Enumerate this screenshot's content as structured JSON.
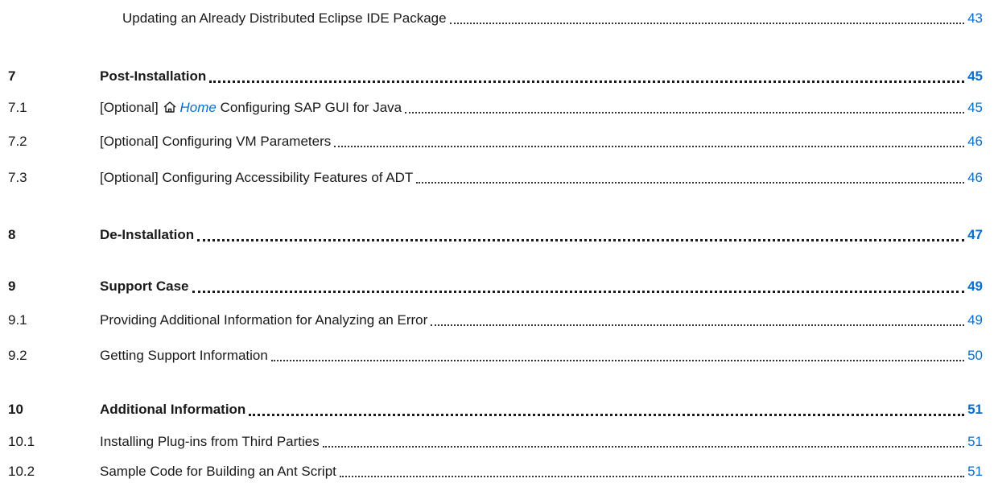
{
  "toc": {
    "r0": {
      "title": "Updating an Already Distributed Eclipse IDE Package",
      "page": "43"
    },
    "r1": {
      "num": "7",
      "title": "Post-Installation",
      "page": "45"
    },
    "r2": {
      "num": "7.1",
      "title_prefix": "[Optional] ",
      "link_icon": "home-icon",
      "link_text": "Home",
      "title_suffix": " Configuring SAP GUI for Java",
      "page": "45"
    },
    "r3": {
      "num": "7.2",
      "title": "[Optional] Configuring VM Parameters",
      "page": "46"
    },
    "r4": {
      "num": "7.3",
      "title": "[Optional] Configuring Accessibility Features of ADT",
      "page": "46"
    },
    "r5": {
      "num": "8",
      "title": "De-Installation",
      "page": "47"
    },
    "r6": {
      "num": "9",
      "title": "Support Case",
      "page": "49"
    },
    "r7": {
      "num": "9.1",
      "title": "Providing Additional Information for Analyzing an Error",
      "page": "49"
    },
    "r8": {
      "num": "9.2",
      "title": "Getting Support Information",
      "page": "50"
    },
    "r9": {
      "num": "10",
      "title": "Additional Information",
      "page": "51"
    },
    "r10": {
      "num": "10.1",
      "title": "Installing Plug-ins from Third Parties",
      "page": "51"
    },
    "r11": {
      "num": "10.2",
      "title": "Sample Code for Building an Ant Script",
      "page": "51"
    }
  },
  "colors": {
    "text": "#1a1a1a",
    "link": "#0a6ed1",
    "leader": "#333333"
  }
}
